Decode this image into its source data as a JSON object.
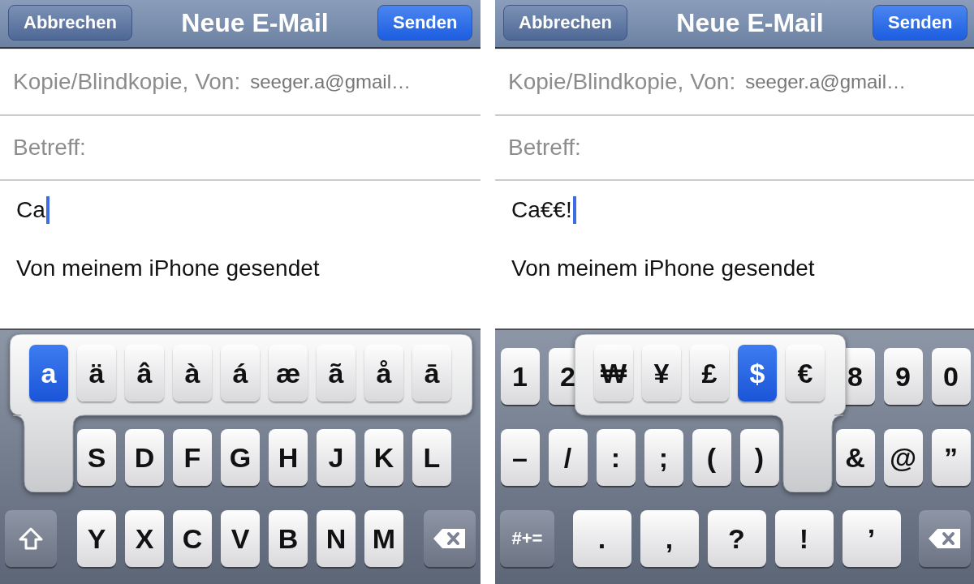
{
  "panels": [
    {
      "nav": {
        "cancel": "Abbrechen",
        "title": "Neue E-Mail",
        "send": "Senden"
      },
      "cc_label": "Kopie/Blindkopie, Von:",
      "cc_value": "seeger.a@gmail…",
      "subject_label": "Betreff:",
      "body_text": "Ca",
      "signature": "Von meinem iPhone gesendet",
      "keyboard": {
        "kind": "letters",
        "rows": [
          {
            "kind": "top",
            "keys": [
              {
                "kind": "covered"
              },
              {
                "kind": "covered"
              },
              {
                "kind": "covered"
              },
              {
                "kind": "covered"
              },
              {
                "kind": "covered"
              },
              {
                "kind": "covered"
              },
              {
                "kind": "covered"
              },
              {
                "kind": "covered"
              },
              {
                "kind": "covered"
              },
              {
                "kind": "covered"
              }
            ]
          },
          {
            "kind": "middle",
            "keys": [
              {
                "kind": "covered"
              },
              {
                "kind": "char",
                "label": "S"
              },
              {
                "kind": "char",
                "label": "D"
              },
              {
                "kind": "char",
                "label": "F"
              },
              {
                "kind": "char",
                "label": "G"
              },
              {
                "kind": "char",
                "label": "H"
              },
              {
                "kind": "char",
                "label": "J"
              },
              {
                "kind": "char",
                "label": "K"
              },
              {
                "kind": "char",
                "label": "L"
              }
            ]
          },
          {
            "kind": "bottom",
            "keys": [
              {
                "kind": "shift"
              },
              {
                "kind": "char",
                "label": "Y"
              },
              {
                "kind": "char",
                "label": "X"
              },
              {
                "kind": "char",
                "label": "C"
              },
              {
                "kind": "char",
                "label": "V"
              },
              {
                "kind": "char",
                "label": "B"
              },
              {
                "kind": "char",
                "label": "N"
              },
              {
                "kind": "char",
                "label": "M"
              },
              {
                "kind": "delete"
              }
            ]
          }
        ],
        "popup": [
          {
            "label": "a",
            "selected": true
          },
          {
            "label": "ä",
            "selected": false
          },
          {
            "label": "â",
            "selected": false
          },
          {
            "label": "à",
            "selected": false
          },
          {
            "label": "á",
            "selected": false
          },
          {
            "label": "æ",
            "selected": false
          },
          {
            "label": "ã",
            "selected": false
          },
          {
            "label": "å",
            "selected": false
          },
          {
            "label": "ā",
            "selected": false
          }
        ]
      }
    },
    {
      "nav": {
        "cancel": "Abbrechen",
        "title": "Neue E-Mail",
        "send": "Senden"
      },
      "cc_label": "Kopie/Blindkopie, Von:",
      "cc_value": "seeger.a@gmail…",
      "subject_label": "Betreff:",
      "body_text": "Ca€€!",
      "signature": "Von meinem iPhone gesendet",
      "keyboard": {
        "kind": "numbers",
        "rows": [
          {
            "kind": "top",
            "keys": [
              {
                "kind": "char",
                "label": "1"
              },
              {
                "kind": "char",
                "label": "2"
              },
              {
                "kind": "covered"
              },
              {
                "kind": "covered"
              },
              {
                "kind": "covered"
              },
              {
                "kind": "covered"
              },
              {
                "kind": "covered"
              },
              {
                "kind": "char",
                "label": "8"
              },
              {
                "kind": "char",
                "label": "9"
              },
              {
                "kind": "char",
                "label": "0"
              }
            ]
          },
          {
            "kind": "middle",
            "keys": [
              {
                "kind": "char",
                "label": "–"
              },
              {
                "kind": "char",
                "label": "/"
              },
              {
                "kind": "char",
                "label": ":"
              },
              {
                "kind": "char",
                "label": ";"
              },
              {
                "kind": "char",
                "label": "("
              },
              {
                "kind": "char",
                "label": ")"
              },
              {
                "kind": "covered"
              },
              {
                "kind": "char",
                "label": "&"
              },
              {
                "kind": "char",
                "label": "@"
              },
              {
                "kind": "char",
                "label": "”"
              }
            ]
          },
          {
            "kind": "bottom",
            "keys": [
              {
                "kind": "mode",
                "label": "#+="
              },
              {
                "kind": "char",
                "label": "."
              },
              {
                "kind": "char",
                "label": ","
              },
              {
                "kind": "char",
                "label": "?"
              },
              {
                "kind": "char",
                "label": "!"
              },
              {
                "kind": "char",
                "label": "’"
              },
              {
                "kind": "delete"
              }
            ]
          }
        ],
        "popup": [
          {
            "label": "₩",
            "selected": false
          },
          {
            "label": "¥",
            "selected": false
          },
          {
            "label": "£",
            "selected": false
          },
          {
            "label": "$",
            "selected": true
          },
          {
            "label": "€",
            "selected": false
          }
        ]
      }
    }
  ]
}
